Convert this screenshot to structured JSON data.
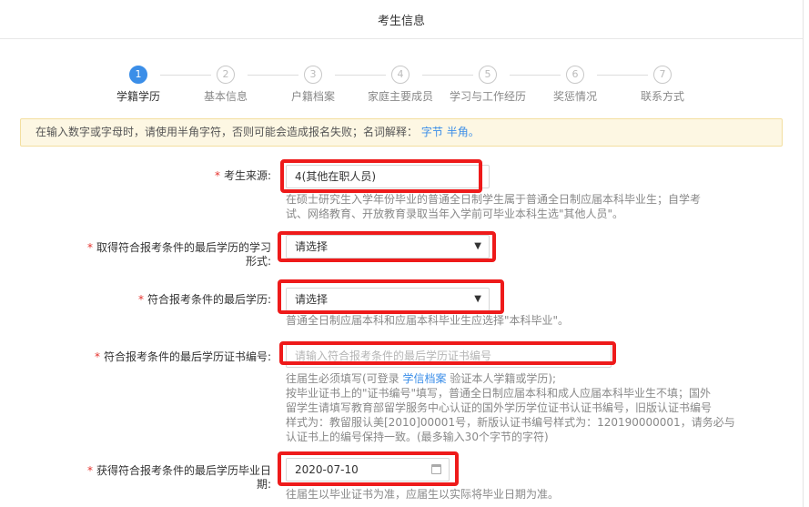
{
  "header": {
    "title": "考生信息"
  },
  "steps": [
    {
      "num": "1",
      "label": "学籍学历"
    },
    {
      "num": "2",
      "label": "基本信息"
    },
    {
      "num": "3",
      "label": "户籍档案"
    },
    {
      "num": "4",
      "label": "家庭主要成员"
    },
    {
      "num": "5",
      "label": "学习与工作经历"
    },
    {
      "num": "6",
      "label": "奖惩情况"
    },
    {
      "num": "7",
      "label": "联系方式"
    }
  ],
  "notice": {
    "text": "在输入数字或字母时，请使用半角字符，否则可能会造成报名失败；名词解释：",
    "link1": "字节",
    "link2": "半角。"
  },
  "form": {
    "source": {
      "label": "考生来源:",
      "value": "4(其他在职人员)",
      "hint_line1": "在硕士研究生入学年份毕业的普通全日制学生属于普通全日制应届本科毕业生；自学考",
      "hint_line2": "试、网络教育、开放教育录取当年入学前可毕业本科生选\"其他人员\"。"
    },
    "study_form": {
      "label_line1": "取得符合报考条件的最后学历的学习",
      "label_line2": "形式:",
      "value": "请选择"
    },
    "last_degree": {
      "label": "符合报考条件的最后学历:",
      "value": "请选择",
      "hint": "普通全日制应届本科和应届本科毕业生应选择\"本科毕业\"。"
    },
    "cert_no": {
      "label": "符合报考条件的最后学历证书编号:",
      "placeholder": "请输入符合报考条件的最后学历证书编号",
      "hint_pre": "往届生必须填写(可登录 ",
      "hint_link": "学信档案",
      "hint_post": " 验证本人学籍或学历);",
      "hint_line2": "按毕业证书上的\"证书编号\"填写，普通全日制应届本科和成人应届本科毕业生不填；国外",
      "hint_line3": "留学生请填写教育部留学服务中心认证的国外学历学位证书认证书编号，旧版认证书编号",
      "hint_line4": "样式为：教留服认美[2010]00001号，新版认证书编号样式为：120190000001，请务必与",
      "hint_line5": "认证书上的编号保持一致。(最多输入30个字节的字符)"
    },
    "grad_date": {
      "label_line1": "获得符合报考条件的最后学历毕业日",
      "label_line2": "期:",
      "value": "2020-07-10",
      "hint": "往届生以毕业证书为准，应届生以实际将毕业日期为准。"
    },
    "required_mark": "*"
  },
  "colors": {
    "accent": "#3b8ee8",
    "highlight": "#ee1a1a",
    "required": "#e5322d",
    "notice_bg": "#fdf7e3"
  }
}
